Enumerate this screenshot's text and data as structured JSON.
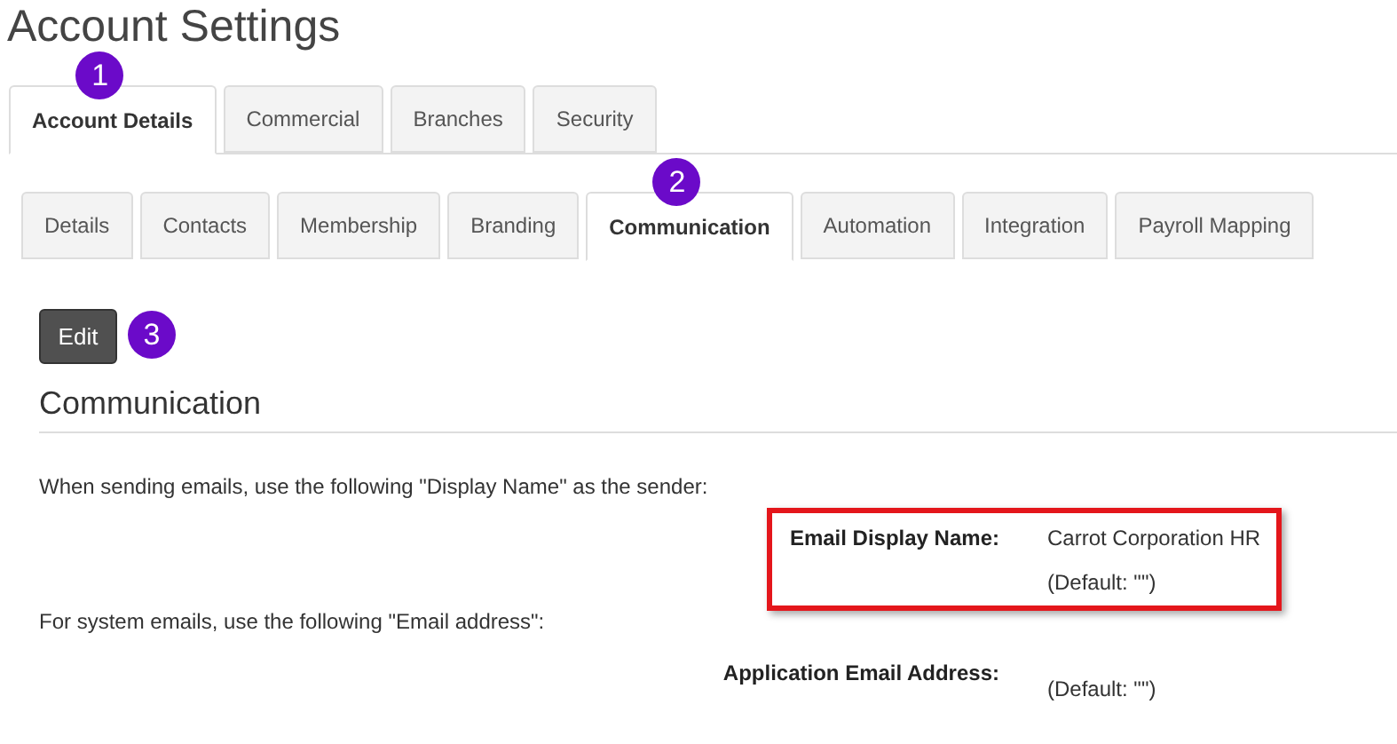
{
  "page_title": "Account Settings",
  "tabs": [
    {
      "label": "Account Details",
      "selected": true,
      "badge": "1"
    },
    {
      "label": "Commercial",
      "selected": false
    },
    {
      "label": "Branches",
      "selected": false
    },
    {
      "label": "Security",
      "selected": false
    }
  ],
  "subtabs": [
    {
      "label": "Details",
      "selected": false
    },
    {
      "label": "Contacts",
      "selected": false
    },
    {
      "label": "Membership",
      "selected": false
    },
    {
      "label": "Branding",
      "selected": false
    },
    {
      "label": "Communication",
      "selected": true,
      "badge": "2"
    },
    {
      "label": "Automation",
      "selected": false
    },
    {
      "label": "Integration",
      "selected": false
    },
    {
      "label": "Payroll Mapping",
      "selected": false
    }
  ],
  "edit_button": {
    "label": "Edit",
    "badge": "3"
  },
  "section": {
    "heading": "Communication",
    "blocks": [
      {
        "kind": "text",
        "text": "When sending emails, use the following \"Display Name\" as the sender:"
      },
      {
        "kind": "field",
        "label": "Email Display Name:",
        "value": "Carrot Corporation HR",
        "default": "(Default: \"\")",
        "highlighted": true
      },
      {
        "kind": "text",
        "text": "For system emails, use the following \"Email address\":"
      },
      {
        "kind": "field",
        "label": "Application Email Address:",
        "default": "(Default: \"\")",
        "highlighted": false
      }
    ]
  }
}
